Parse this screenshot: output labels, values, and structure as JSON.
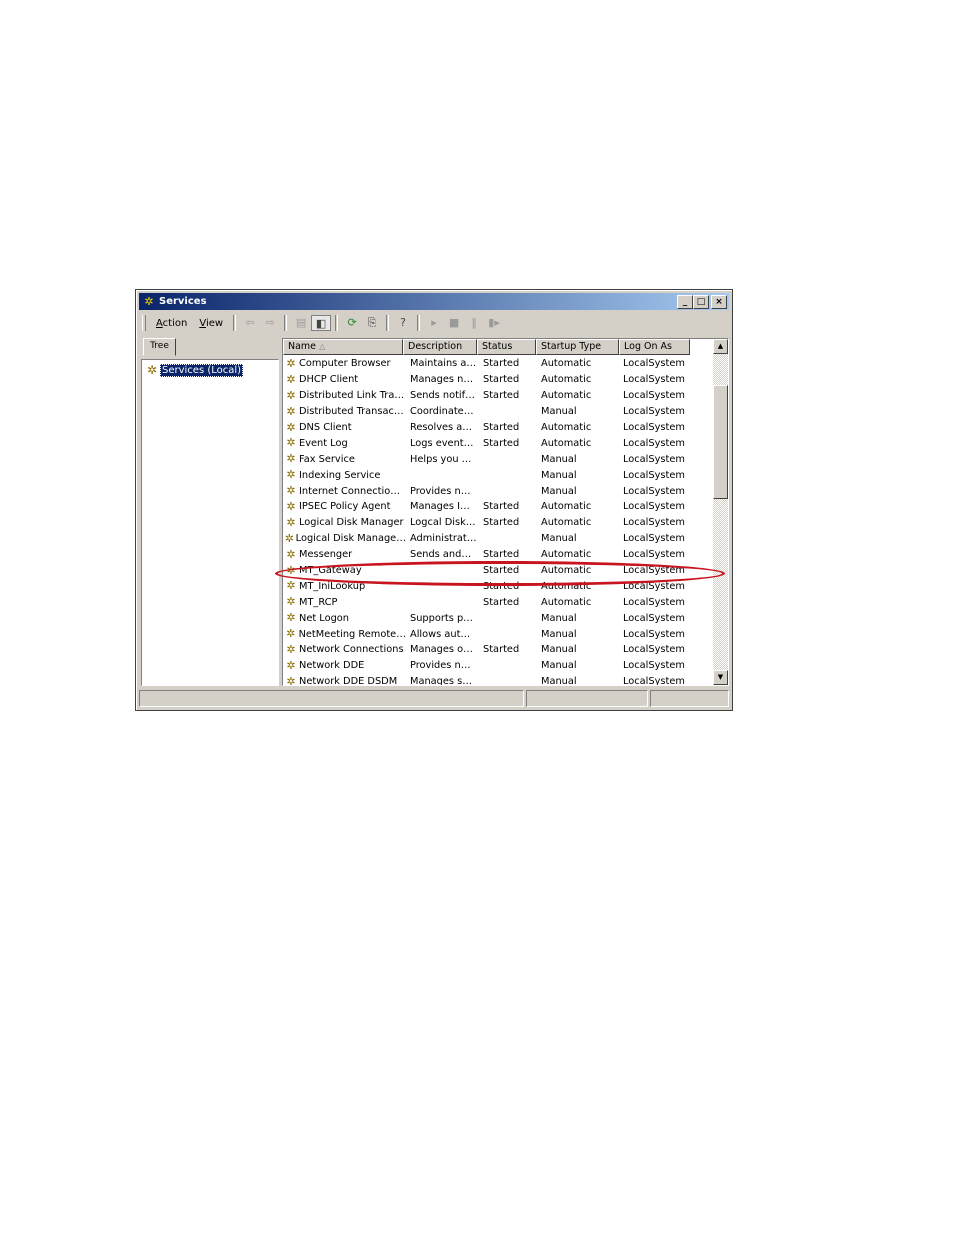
{
  "window": {
    "title": "Services",
    "controls": {
      "minimize": "_",
      "maximize": "□",
      "close": "×"
    }
  },
  "toolbar": {
    "menus": [
      {
        "label": "Action",
        "accel": "A",
        "rest": "ction"
      },
      {
        "label": "View",
        "accel": "V",
        "rest": "iew"
      }
    ],
    "icons": [
      "back-arrow-icon",
      "forward-arrow-icon",
      "up-folder-icon",
      "show-hide-tree-icon",
      "refresh-icon",
      "export-list-icon",
      "help-icon",
      "start-service-icon",
      "stop-service-icon",
      "pause-service-icon",
      "restart-service-icon"
    ]
  },
  "tree": {
    "tab_label": "Tree",
    "root": "Services (Local)"
  },
  "list": {
    "columns": [
      "Name",
      "Description",
      "Status",
      "Startup Type",
      "Log On As"
    ],
    "sort_column": "Name",
    "rows": [
      {
        "name": "Computer Browser",
        "description": "Maintains a…",
        "status": "Started",
        "startup": "Automatic",
        "logon": "LocalSystem"
      },
      {
        "name": "DHCP Client",
        "description": "Manages n…",
        "status": "Started",
        "startup": "Automatic",
        "logon": "LocalSystem"
      },
      {
        "name": "Distributed Link Tra…",
        "description": "Sends notif…",
        "status": "Started",
        "startup": "Automatic",
        "logon": "LocalSystem"
      },
      {
        "name": "Distributed Transac…",
        "description": "Coordinate…",
        "status": "",
        "startup": "Manual",
        "logon": "LocalSystem"
      },
      {
        "name": "DNS Client",
        "description": "Resolves a…",
        "status": "Started",
        "startup": "Automatic",
        "logon": "LocalSystem"
      },
      {
        "name": "Event Log",
        "description": "Logs event…",
        "status": "Started",
        "startup": "Automatic",
        "logon": "LocalSystem"
      },
      {
        "name": "Fax Service",
        "description": "Helps you …",
        "status": "",
        "startup": "Manual",
        "logon": "LocalSystem"
      },
      {
        "name": "Indexing Service",
        "description": "",
        "status": "",
        "startup": "Manual",
        "logon": "LocalSystem"
      },
      {
        "name": "Internet Connectio…",
        "description": "Provides n…",
        "status": "",
        "startup": "Manual",
        "logon": "LocalSystem"
      },
      {
        "name": "IPSEC Policy Agent",
        "description": "Manages I…",
        "status": "Started",
        "startup": "Automatic",
        "logon": "LocalSystem"
      },
      {
        "name": "Logical Disk Manager",
        "description": "Logcal Disk…",
        "status": "Started",
        "startup": "Automatic",
        "logon": "LocalSystem"
      },
      {
        "name": "Logical Disk Manage…",
        "description": "Administrat…",
        "status": "",
        "startup": "Manual",
        "logon": "LocalSystem"
      },
      {
        "name": "Messenger",
        "description": "Sends and…",
        "status": "Started",
        "startup": "Automatic",
        "logon": "LocalSystem"
      },
      {
        "name": "MT_Gateway",
        "description": "",
        "status": "Started",
        "startup": "Automatic",
        "logon": "LocalSystem"
      },
      {
        "name": "MT_IniLookup",
        "description": "",
        "status": "Started",
        "startup": "Automatic",
        "logon": "LocalSystem"
      },
      {
        "name": "MT_RCP",
        "description": "",
        "status": "Started",
        "startup": "Automatic",
        "logon": "LocalSystem"
      },
      {
        "name": "Net Logon",
        "description": "Supports p…",
        "status": "",
        "startup": "Manual",
        "logon": "LocalSystem"
      },
      {
        "name": "NetMeeting Remote…",
        "description": "Allows aut…",
        "status": "",
        "startup": "Manual",
        "logon": "LocalSystem"
      },
      {
        "name": "Network Connections",
        "description": "Manages o…",
        "status": "Started",
        "startup": "Manual",
        "logon": "LocalSystem"
      },
      {
        "name": "Network DDE",
        "description": "Provides n…",
        "status": "",
        "startup": "Manual",
        "logon": "LocalSystem"
      },
      {
        "name": "Network DDE DSDM",
        "description": "Manages s…",
        "status": "",
        "startup": "Manual",
        "logon": "LocalSystem"
      }
    ]
  },
  "annotation": {
    "highlighted_row": "MT_Gateway",
    "color": "#c8141e"
  }
}
